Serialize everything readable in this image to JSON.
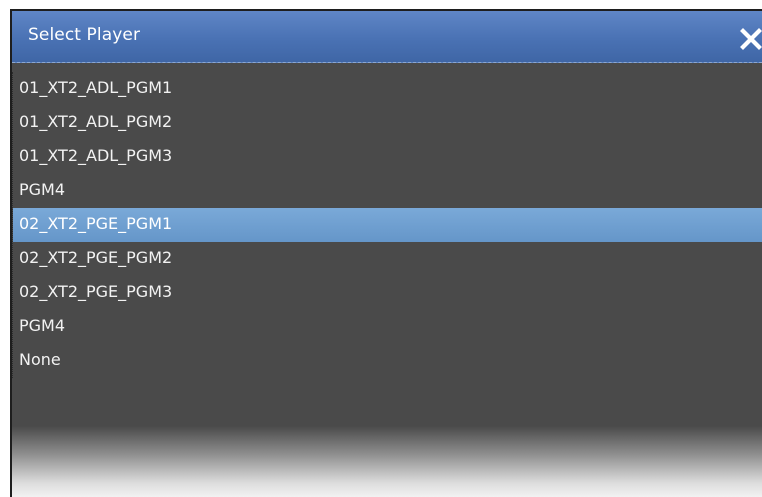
{
  "dialog": {
    "title": "Select Player",
    "close_icon": "close-icon",
    "selected_index": 4
  },
  "players": [
    "01_XT2_ADL_PGM1",
    "01_XT2_ADL_PGM2",
    "01_XT2_ADL_PGM3",
    "PGM4",
    "02_XT2_PGE_PGM1",
    "02_XT2_PGE_PGM2",
    "02_XT2_PGE_PGM3",
    "PGM4",
    "None"
  ],
  "colors": {
    "titlebar": "#4a72b4",
    "list_background": "#4a4a4a",
    "selection": "#6f9fd1",
    "text": "#f2f2f2"
  }
}
